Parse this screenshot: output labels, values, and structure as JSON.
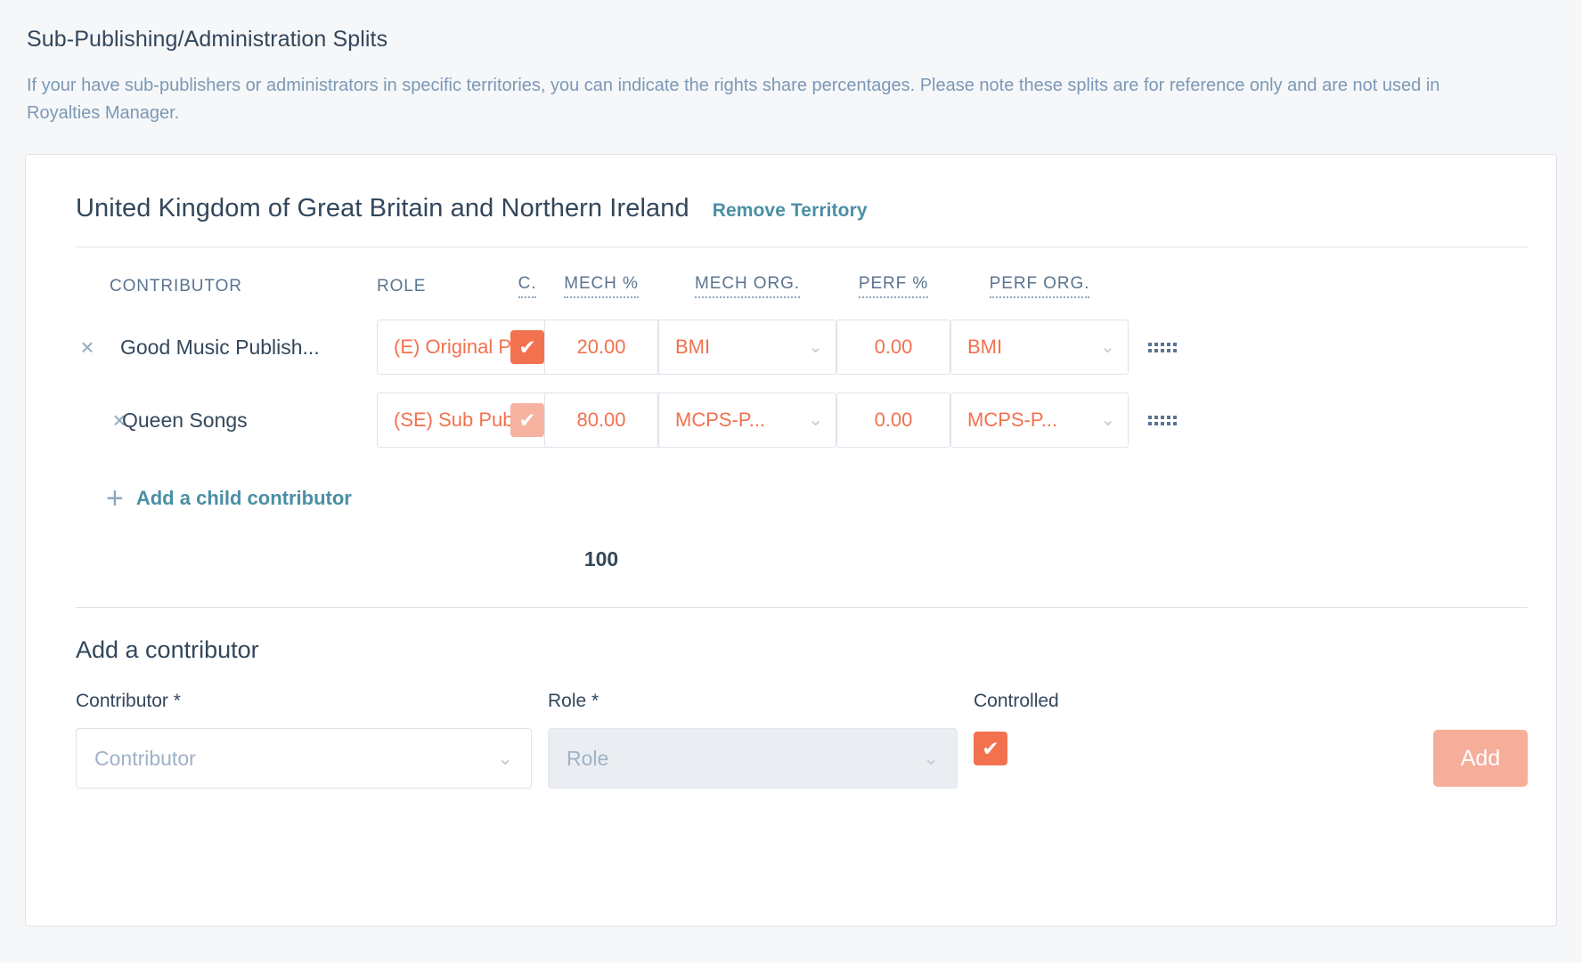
{
  "section": {
    "title": "Sub-Publishing/Administration Splits",
    "description": "If your have sub-publishers or administrators in specific territories, you can indicate the rights share percentages. Please note these splits are for reference only and are not used in Royalties Manager."
  },
  "territory": {
    "name": "United Kingdom of Great Britain and Northern Ireland",
    "remove_label": "Remove Territory"
  },
  "columns": {
    "contributor": "CONTRIBUTOR",
    "role": "ROLE",
    "controlled": "C.",
    "mech_pct": "MECH %",
    "mech_org": "MECH ORG.",
    "perf_pct": "PERF %",
    "perf_org": "PERF ORG."
  },
  "rows": [
    {
      "name": "Good Music Publish...",
      "role": "(E) Original Publisher",
      "controlled": true,
      "controlled_muted": false,
      "mech_pct": "20.00",
      "mech_org": "BMI",
      "perf_pct": "0.00",
      "perf_org": "BMI",
      "check_glyph": "✔",
      "remove_glyph": "×"
    },
    {
      "name": "Queen Songs",
      "role": "(SE) Sub Publisher",
      "controlled": true,
      "controlled_muted": true,
      "mech_pct": "80.00",
      "mech_org": "MCPS-P...",
      "perf_pct": "0.00",
      "perf_org": "MCPS-P...",
      "check_glyph": "✔",
      "remove_glyph": "×"
    }
  ],
  "add_child": {
    "label": "Add a child contributor",
    "plus_glyph": "+"
  },
  "total": "100",
  "add_contributor": {
    "title": "Add a contributor",
    "contributor_label": "Contributor *",
    "contributor_placeholder": "Contributor",
    "role_label": "Role *",
    "role_placeholder": "Role",
    "controlled_label": "Controlled",
    "controlled_checked": true,
    "check_glyph": "✔",
    "add_button": "Add"
  },
  "icons": {
    "caret_down": "⌄"
  },
  "colors": {
    "accent_orange": "#f2714f",
    "accent_orange_muted": "#f5b3a0",
    "link_teal": "#4a8fa5",
    "text_slate": "#33475b",
    "text_muted": "#7c98b6",
    "border": "#dfe3eb",
    "page_bg": "#f5f7f9"
  }
}
